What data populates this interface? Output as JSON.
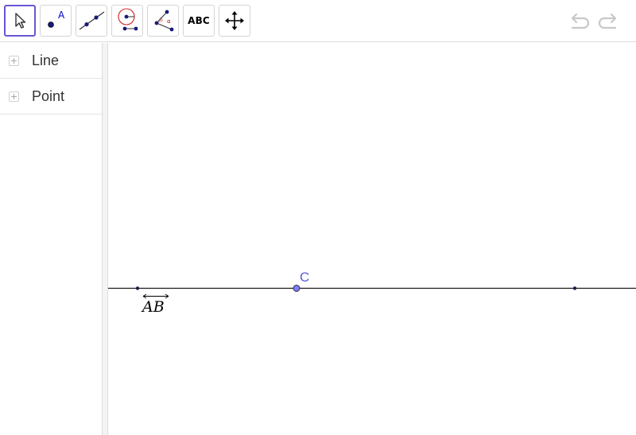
{
  "toolbar": {
    "tools": [
      {
        "id": "move",
        "name": "Move"
      },
      {
        "id": "point",
        "name": "Point",
        "icon_letter": "A"
      },
      {
        "id": "line",
        "name": "Line"
      },
      {
        "id": "circle",
        "name": "Circle with Center through Point"
      },
      {
        "id": "angle",
        "name": "Angle",
        "icon_letter": "α"
      },
      {
        "id": "text",
        "label": "ABC"
      },
      {
        "id": "move-graphics",
        "name": "Move Graphics View"
      }
    ],
    "active_tool": "move",
    "undo": {
      "icon": "undo-icon"
    },
    "redo": {
      "icon": "redo-icon"
    }
  },
  "algebra": {
    "items": [
      {
        "label": "Line"
      },
      {
        "label": "Point"
      }
    ]
  },
  "graphics": {
    "point_label": "C",
    "line_label_math": "AB"
  },
  "colors": {
    "active_tool_border": "#6557d2",
    "point_fill": "#7d7dff",
    "point_label": "#5c5cdb",
    "line": "#1a1a1a",
    "icon_blue": "#0000cc",
    "icon_red": "#cc0000"
  }
}
